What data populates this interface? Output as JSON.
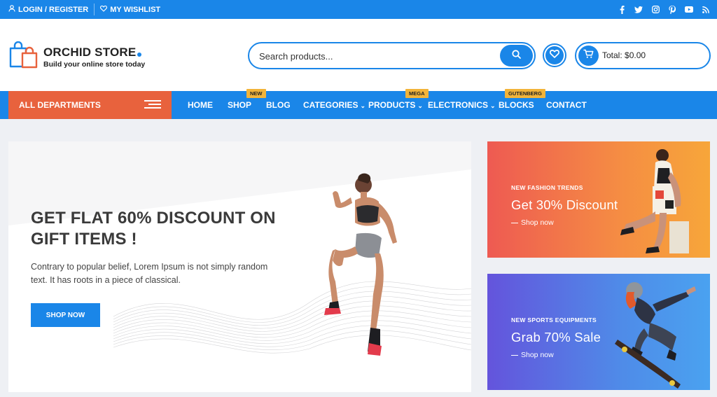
{
  "topbar": {
    "login_label": "LOGIN / REGISTER",
    "wishlist_label": "MY WISHLIST",
    "social_icons": [
      "facebook-icon",
      "twitter-icon",
      "instagram-icon",
      "pinterest-icon",
      "youtube-icon",
      "rss-icon"
    ]
  },
  "brand": {
    "name": "ORCHID STORE",
    "tagline": "Build your online store today"
  },
  "search": {
    "placeholder": "Search products..."
  },
  "cart": {
    "total_label": "Total: $0.00"
  },
  "nav": {
    "departments_label": "ALL DEPARTMENTS",
    "items": [
      {
        "label": "HOME"
      },
      {
        "label": "SHOP",
        "badge": "NEW"
      },
      {
        "label": "BLOG"
      },
      {
        "label": "CATEGORIES"
      },
      {
        "label": "PRODUCTS",
        "badge": "MEGA"
      },
      {
        "label": "ELECTRONICS"
      },
      {
        "label": "BLOCKS",
        "badge": "GUTENBERG"
      },
      {
        "label": "CONTACT"
      }
    ]
  },
  "hero": {
    "title": "GET FLAT 60% DISCOUNT ON GIFT ITEMS !",
    "text": "Contrary to popular belief, Lorem Ipsum is not simply random text. It has roots in a piece of classical.",
    "button": "SHOP NOW"
  },
  "promos": [
    {
      "kicker": "NEW FASHION TRENDS",
      "title": "Get 30% Discount",
      "link": "Shop now"
    },
    {
      "kicker": "NEW SPORTS EQUIPMENTS",
      "title": "Grab 70% Sale",
      "link": "Shop now"
    }
  ],
  "colors": {
    "primary": "#1a86e8",
    "departments": "#e8623d",
    "badge": "#f2b43a"
  }
}
